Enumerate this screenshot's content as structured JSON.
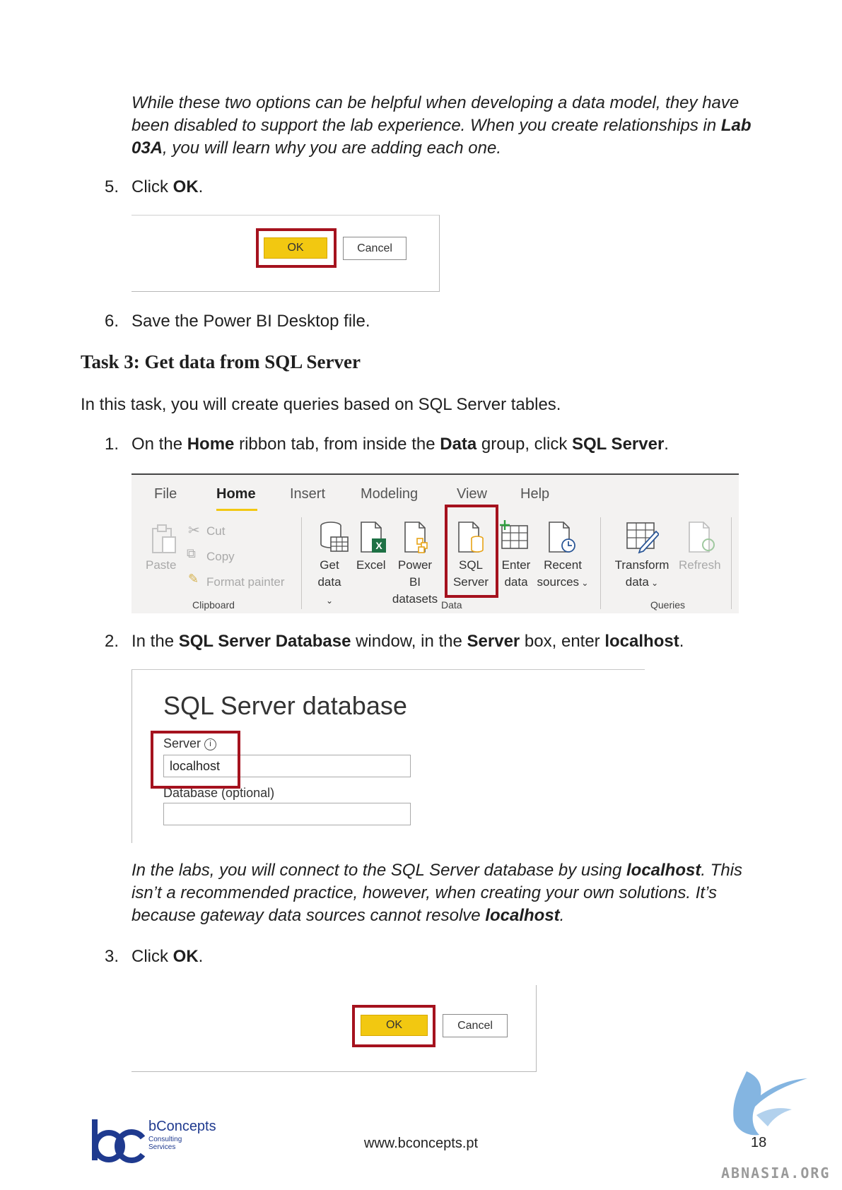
{
  "note1": {
    "pre": "While these two options can be helpful when developing a data model, they have been disabled to support the lab experience. When you create relationships in ",
    "bold": "Lab 03A",
    "post": ", you will learn why you are adding each one."
  },
  "step5": {
    "number": "5.",
    "text": "Click ",
    "bold": "OK",
    "end": "."
  },
  "dialog_buttons": {
    "ok": "OK",
    "cancel": "Cancel"
  },
  "step6": {
    "number": "6.",
    "text": "Save the Power BI Desktop file."
  },
  "task3": {
    "heading": "Task 3: Get data from SQL Server",
    "intro": "In this task, you will create queries based on SQL Server tables."
  },
  "step1": {
    "number": "1.",
    "t1": "On the ",
    "b1": "Home",
    "t2": " ribbon tab, from inside the ",
    "b2": "Data",
    "t3": " group, click ",
    "b3": "SQL Server",
    "t4": "."
  },
  "ribbon": {
    "tabs": [
      "File",
      "Home",
      "Insert",
      "Modeling",
      "View",
      "Help"
    ],
    "clipboard": {
      "paste": "Paste",
      "cut": "Cut",
      "copy": "Copy",
      "format_painter": "Format painter",
      "group": "Clipboard"
    },
    "data": {
      "get_data": [
        "Get",
        "data"
      ],
      "excel": "Excel",
      "power_bi": [
        "Power BI",
        "datasets"
      ],
      "sql": [
        "SQL",
        "Server"
      ],
      "enter": [
        "Enter",
        "data"
      ],
      "recent": [
        "Recent",
        "sources"
      ],
      "group": "Data"
    },
    "queries": {
      "transform": [
        "Transform",
        "data"
      ],
      "refresh": "Refresh",
      "group": "Queries"
    }
  },
  "step2": {
    "number": "2.",
    "t1": "In the ",
    "b1": "SQL Server Database",
    "t2": " window, in the ",
    "b2": "Server",
    "t3": " box, enter ",
    "b3": "localhost",
    "t4": "."
  },
  "sql_dialog": {
    "title": "SQL Server database",
    "server_label": "Server",
    "server_value": "localhost",
    "database_label": "Database (optional)",
    "database_value": ""
  },
  "note2": {
    "t1": "In the labs, you will connect to the SQL Server database by using ",
    "b1": "localhost",
    "t2": ". This isn’t a recommended practice, however, when creating your own solutions. It’s because gateway data sources cannot resolve ",
    "b2": "localhost",
    "t3": "."
  },
  "step3": {
    "number": "3.",
    "text": "Click ",
    "bold": "OK",
    "end": "."
  },
  "footer": {
    "brand": "bConcepts",
    "brand_sub1": "Consulting",
    "brand_sub2": "Services",
    "url": "www.bconcepts.pt",
    "page": "18",
    "watermark": "ABNASIA.ORG"
  },
  "colors": {
    "highlight_red": "#a5121e",
    "ok_yellow": "#f2c811",
    "brand_blue": "#1f3a8f"
  }
}
